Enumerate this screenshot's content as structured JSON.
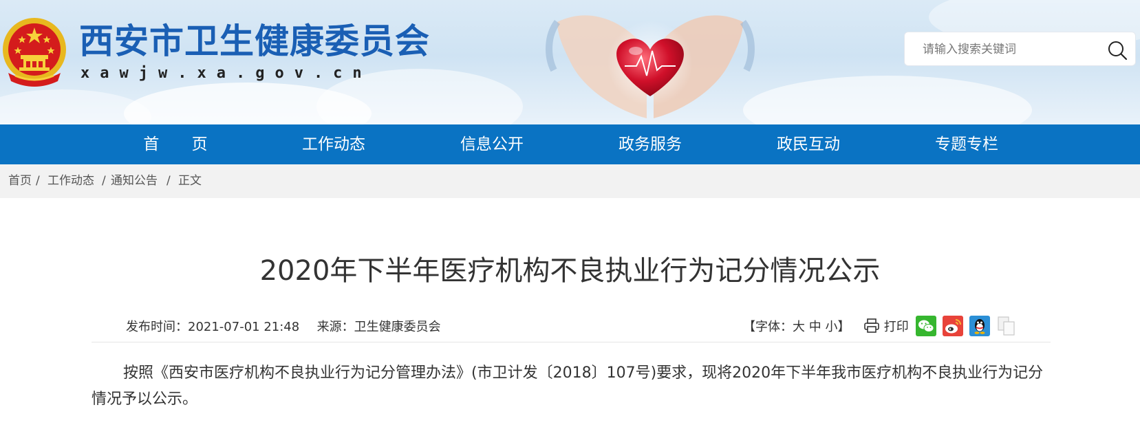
{
  "header": {
    "site_title": "西安市卫生健康委员会",
    "site_domain": "xawjw.xa.gov.cn",
    "search": {
      "placeholder": "请输入搜索关键词"
    }
  },
  "nav": {
    "items": [
      {
        "label": "首 页"
      },
      {
        "label": "工作动态"
      },
      {
        "label": "信息公开"
      },
      {
        "label": "政务服务"
      },
      {
        "label": "政民互动"
      },
      {
        "label": "专题专栏"
      }
    ]
  },
  "breadcrumb": {
    "items": [
      {
        "label": "首页"
      },
      {
        "label": "工作动态"
      },
      {
        "label": "通知公告"
      },
      {
        "label": "正文"
      }
    ],
    "separator": "/"
  },
  "article": {
    "title": "2020年下半年医疗机构不良执业行为记分情况公示",
    "publish_label": "发布时间：",
    "publish_time": "2021-07-01 21:48",
    "source_label": "来源：",
    "source": "卫生健康委员会",
    "font_size": {
      "prefix": "【字体：",
      "large": "大",
      "medium": "中",
      "small": "小",
      "suffix": "】"
    },
    "print_label": "打印",
    "body": "按照《西安市医疗机构不良执业行为记分管理办法》(市卫计发〔2018〕107号)要求，现将2020年下半年我市医疗机构不良执业行为记分情况予以公示。"
  },
  "colors": {
    "brand_blue": "#0a73c3",
    "title_blue": "#1a5fb4",
    "breadcrumb_bg": "#f2f2f2"
  },
  "icons": [
    "national-emblem-icon",
    "search-icon",
    "printer-icon",
    "wechat-icon",
    "weibo-icon",
    "qq-icon",
    "copy-icon"
  ]
}
